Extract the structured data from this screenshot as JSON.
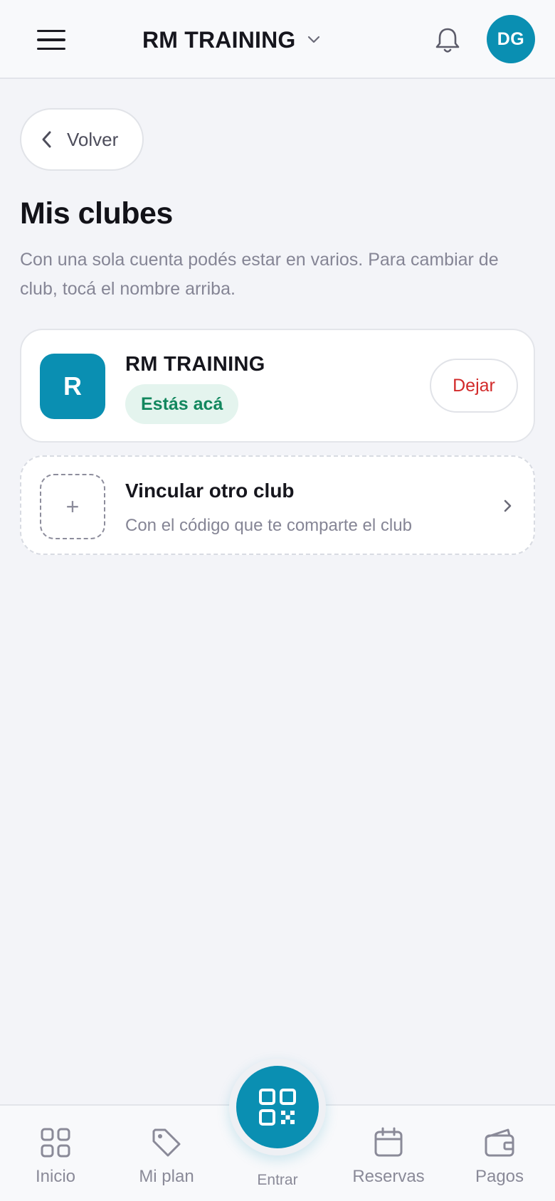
{
  "header": {
    "club_name": "RM TRAINING",
    "avatar_initials": "DG",
    "icons": {
      "menu": "hamburger-icon",
      "dropdown": "chevron-down-icon",
      "notifications": "bell-icon"
    }
  },
  "back": {
    "label": "Volver",
    "icon": "chevron-left-icon"
  },
  "page": {
    "title": "Mis clubes",
    "description": "Con una sola cuenta podés estar en varios. Para cambiar de club, tocá el nombre arriba."
  },
  "clubs": [
    {
      "logo_letter": "R",
      "name": "RM TRAINING",
      "badge": "Estás acá",
      "action": "Dejar"
    }
  ],
  "link_club": {
    "plus": "+",
    "title": "Vincular otro club",
    "subtitle": "Con el código que te comparte el club",
    "icon": "chevron-right-icon"
  },
  "bottom_nav": {
    "items": [
      {
        "label": "Inicio",
        "icon": "grid-icon"
      },
      {
        "label": "Mi plan",
        "icon": "tag-icon"
      },
      {
        "label": "Reservas",
        "icon": "calendar-icon"
      },
      {
        "label": "Pagos",
        "icon": "wallet-icon"
      }
    ],
    "center": {
      "label": "Entrar",
      "icon": "qr-code-icon"
    }
  },
  "colors": {
    "brand": "#0a8fb2",
    "danger": "#d22a2a",
    "success": "#12875e",
    "background": "#f3f4f8"
  }
}
